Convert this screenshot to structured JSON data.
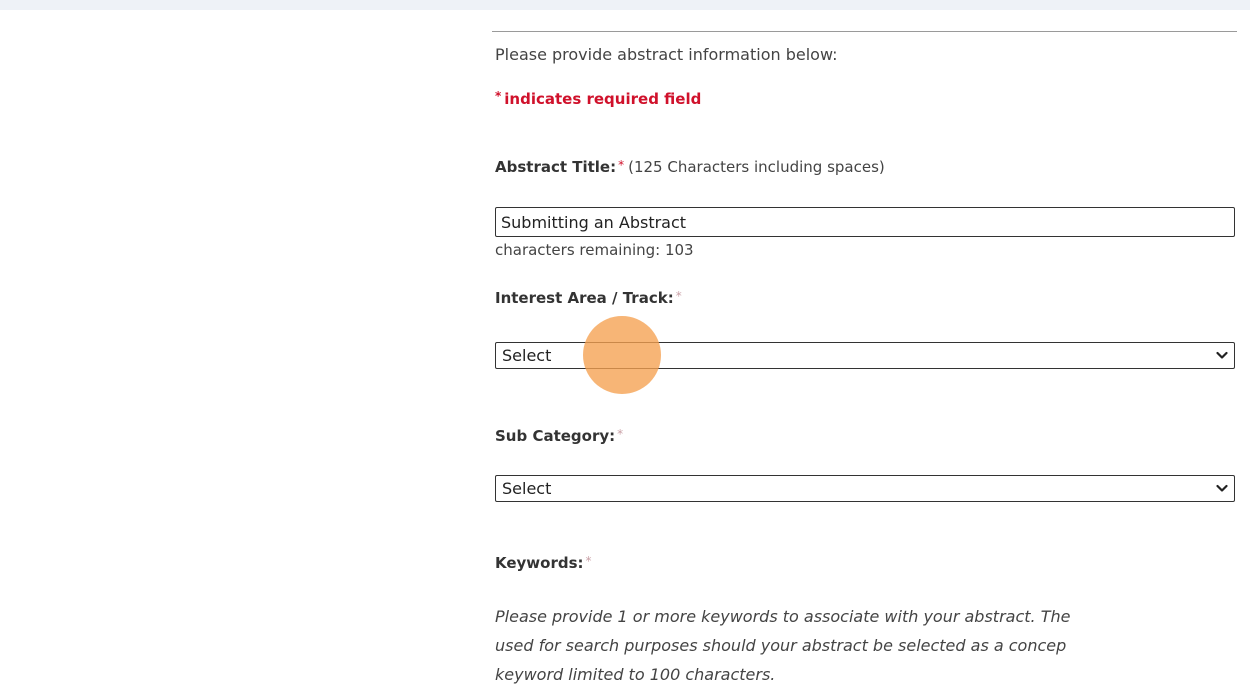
{
  "form": {
    "intro": "Please provide abstract information below:",
    "required_note": {
      "star": "*",
      "text": "indicates required field"
    },
    "abstract_title": {
      "label": "Abstract Title:",
      "star": "*",
      "hint": "(125 Characters including spaces)",
      "value": "Submitting an Abstract",
      "chars_remaining": "characters remaining: 103"
    },
    "interest_area": {
      "label": "Interest Area / Track:",
      "star": "*",
      "selected": "Select"
    },
    "sub_category": {
      "label": "Sub Category:",
      "star": "*",
      "selected": "Select"
    },
    "keywords": {
      "label": "Keywords:",
      "star": "*",
      "help_lines": [
        "Please provide 1 or more keywords to associate with your abstract. The",
        "used for search purposes should your abstract be selected as a concep",
        "keyword limited to 100 characters."
      ]
    }
  },
  "colors": {
    "required": "#d0112b",
    "click_marker": "#f5a050"
  },
  "icons": {
    "dropdown": "chevron-down-icon"
  }
}
